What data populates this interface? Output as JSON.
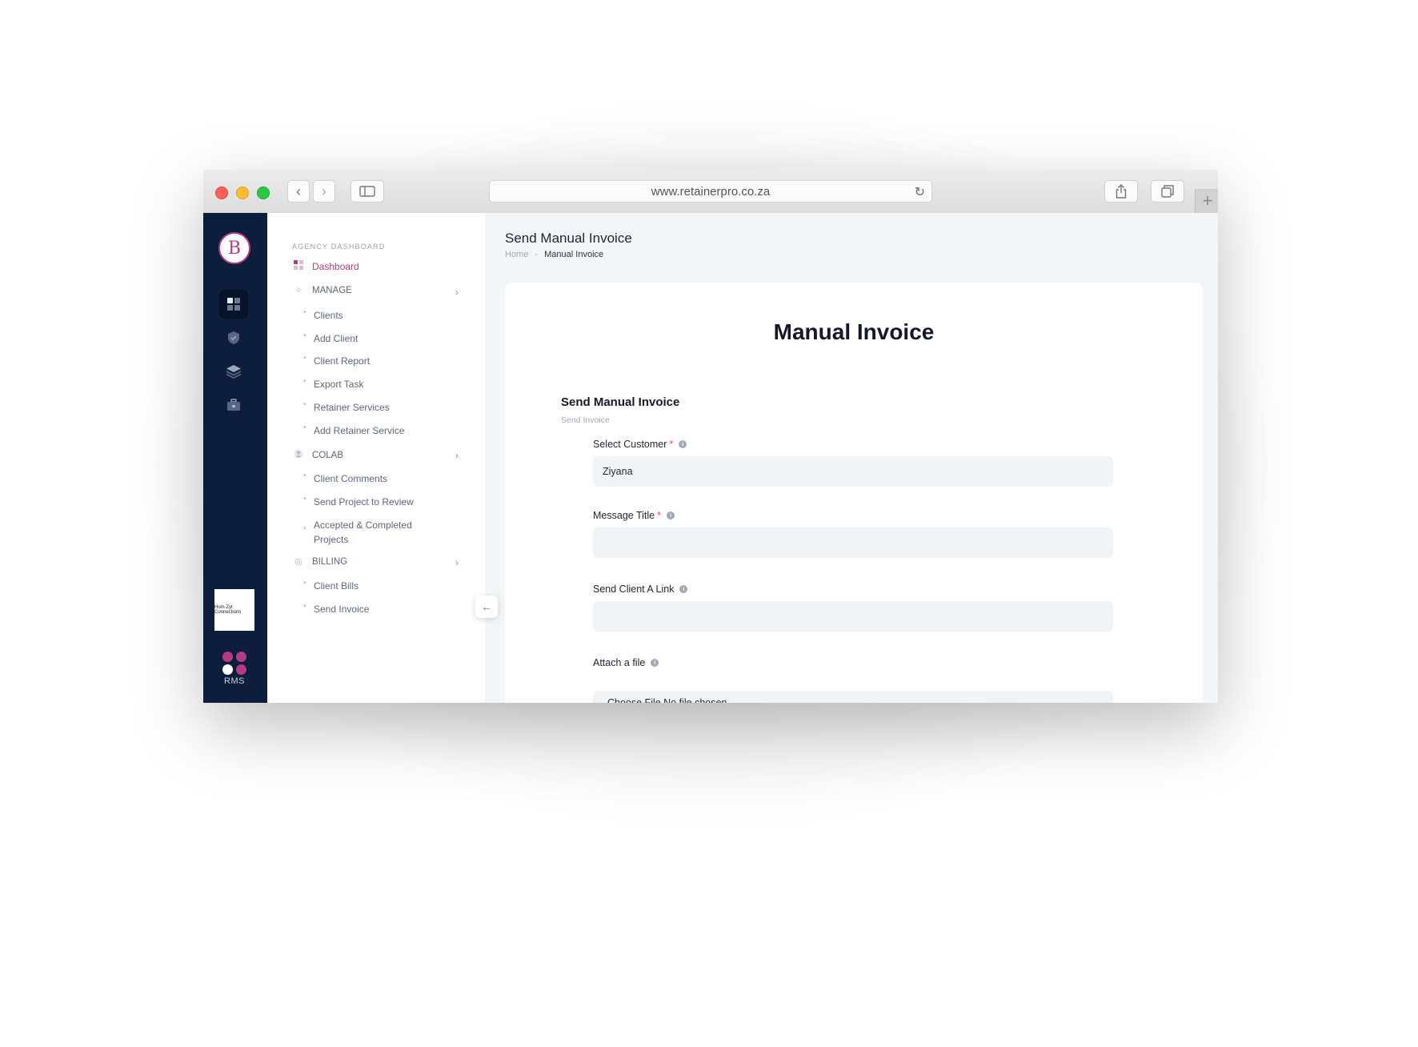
{
  "browser": {
    "url": "www.retainerpro.co.za"
  },
  "rail": {
    "logo_letter": "B",
    "client_logo_text": "Hom Zyt Connections",
    "rms_label": "RMS",
    "rms_colors": [
      "#b63b86",
      "#b63b86",
      "#ffffff",
      "#b63b86"
    ]
  },
  "sidebar": {
    "heading": "AGENCY DASHBOARD",
    "dashboard": "Dashboard",
    "sections": {
      "manage": {
        "title": "MANAGE",
        "items": [
          "Clients",
          "Add Client",
          "Client Report",
          "Export Task",
          "Retainer Services",
          "Add Retainer Service"
        ]
      },
      "colab": {
        "title": "COLAB",
        "items": [
          "Client Comments",
          "Send Project to Review",
          "Accepted & Completed Projects"
        ]
      },
      "billing": {
        "title": "BILLING",
        "items": [
          "Client Bills",
          "Send Invoice"
        ]
      }
    }
  },
  "header": {
    "title": "Send Manual Invoice",
    "breadcrumb_home": "Home",
    "breadcrumb_sep": "-",
    "breadcrumb_current": "Manual Invoice"
  },
  "card": {
    "title": "Manual Invoice",
    "section_title": "Send Manual Invoice",
    "section_subtitle": "Send Invoice",
    "fields": {
      "customer": {
        "label": "Select Customer",
        "value": "Ziyana"
      },
      "message_title": {
        "label": "Message Title",
        "value": ""
      },
      "client_link": {
        "label": "Send Client A Link",
        "value": ""
      },
      "attach": {
        "label": "Attach a file",
        "value": "Choose File   No file chosen"
      }
    }
  },
  "colors": {
    "accent": "#b63b86",
    "rail_bg": "#0d1e3c",
    "required": "#f1416c"
  }
}
